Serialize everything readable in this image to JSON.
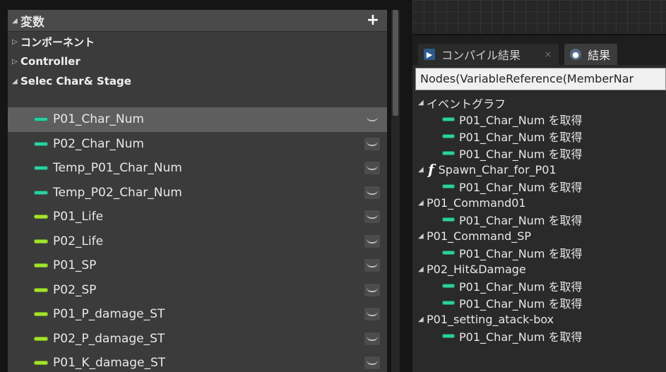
{
  "variables_panel": {
    "header": "変数",
    "add_label": "+",
    "categories": [
      {
        "label": "コンポーネント",
        "expanded": false
      },
      {
        "label": "Controller",
        "expanded": false
      },
      {
        "label": "Selec Char& Stage",
        "expanded": true
      }
    ],
    "variables": [
      {
        "name": "P01_Char_Num",
        "type": "int",
        "selected": true
      },
      {
        "name": "P02_Char_Num",
        "type": "int"
      },
      {
        "name": "Temp_P01_Char_Num",
        "type": "int"
      },
      {
        "name": "Temp_P02_Char_Num",
        "type": "int"
      },
      {
        "name": "P01_Life",
        "type": "float"
      },
      {
        "name": "P02_Life",
        "type": "float"
      },
      {
        "name": "P01_SP",
        "type": "float"
      },
      {
        "name": "P02_SP",
        "type": "float"
      },
      {
        "name": "P01_P_damage_ST",
        "type": "float"
      },
      {
        "name": "P02_P_damage_ST",
        "type": "float"
      },
      {
        "name": "P01_K_damage_ST",
        "type": "float"
      }
    ]
  },
  "results_panel": {
    "tabs": [
      {
        "label": "コンパイル結果",
        "close": "×"
      },
      {
        "label": "結果"
      }
    ],
    "search_query": "Nodes(VariableReference(MemberNar",
    "results": [
      {
        "kind": "group",
        "label": "イベントグラフ"
      },
      {
        "kind": "item",
        "label": "P01_Char_Num を取得"
      },
      {
        "kind": "item",
        "label": "P01_Char_Num を取得"
      },
      {
        "kind": "item",
        "label": "P01_Char_Num を取得"
      },
      {
        "kind": "function",
        "label": "Spawn_Char_for_P01"
      },
      {
        "kind": "item",
        "label": "P01_Char_Num を取得"
      },
      {
        "kind": "group",
        "label": "P01_Command01"
      },
      {
        "kind": "item",
        "label": "P01_Char_Num を取得"
      },
      {
        "kind": "group",
        "label": "P01_Command_SP"
      },
      {
        "kind": "item",
        "label": "P01_Char_Num を取得"
      },
      {
        "kind": "group",
        "label": "P02_Hit&Damage"
      },
      {
        "kind": "item",
        "label": "P01_Char_Num を取得"
      },
      {
        "kind": "item",
        "label": "P01_Char_Num を取得"
      },
      {
        "kind": "group",
        "label": "P01_setting_atack-box"
      },
      {
        "kind": "item",
        "label": "P01_Char_Num を取得"
      }
    ]
  },
  "colors": {
    "int_pin": "#2fcf9f",
    "float_pin": "#a6e22e",
    "selected_row": "#5e5e5e"
  },
  "icons": [
    "plus-icon",
    "collapse-triangle-icon",
    "expand-triangle-icon",
    "eye-closed-icon",
    "compile-results-icon",
    "search-icon",
    "function-icon",
    "variable-pin-icon"
  ]
}
